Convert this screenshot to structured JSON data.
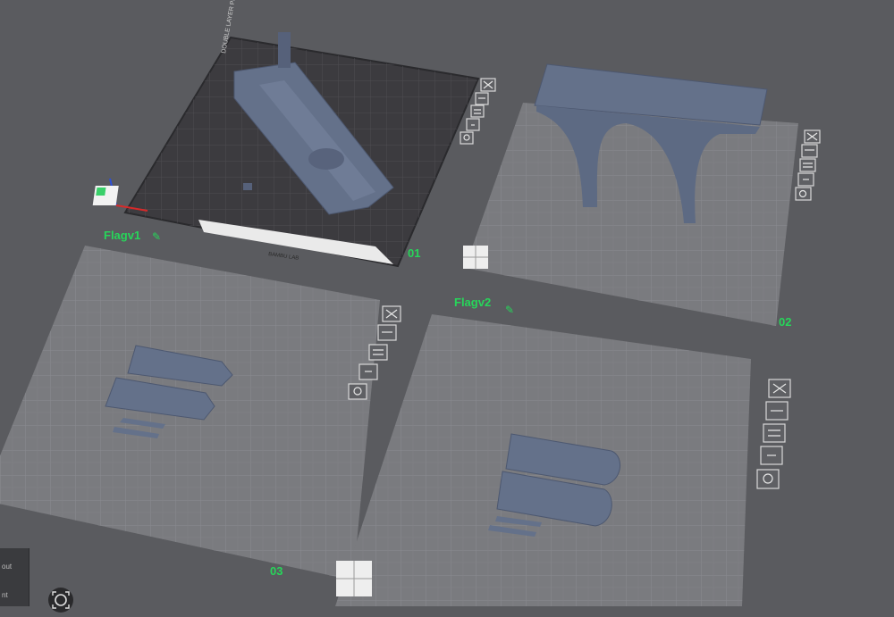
{
  "plates": [
    {
      "number": "01",
      "name": ""
    },
    {
      "number": "02",
      "name": ""
    },
    {
      "number": "03",
      "name": "Flagv1"
    },
    {
      "number": "",
      "name": "Flagv2"
    }
  ],
  "bed_logo_text": "DOUBLE LAYER PLATE",
  "bed_footer_text": "BAMBU LAB",
  "view_controls": {
    "label_1": "out",
    "label_2": "nt"
  },
  "tools": [
    "close-icon",
    "arrange-icon",
    "slice-plate-icon",
    "lock-icon",
    "settings-icon"
  ],
  "colors": {
    "background": "#5a5b5f",
    "plate_light": "#7a7b7f",
    "plate_dark": "#3c3b3f",
    "model": "#64718a",
    "label_green": "#27d65a"
  }
}
